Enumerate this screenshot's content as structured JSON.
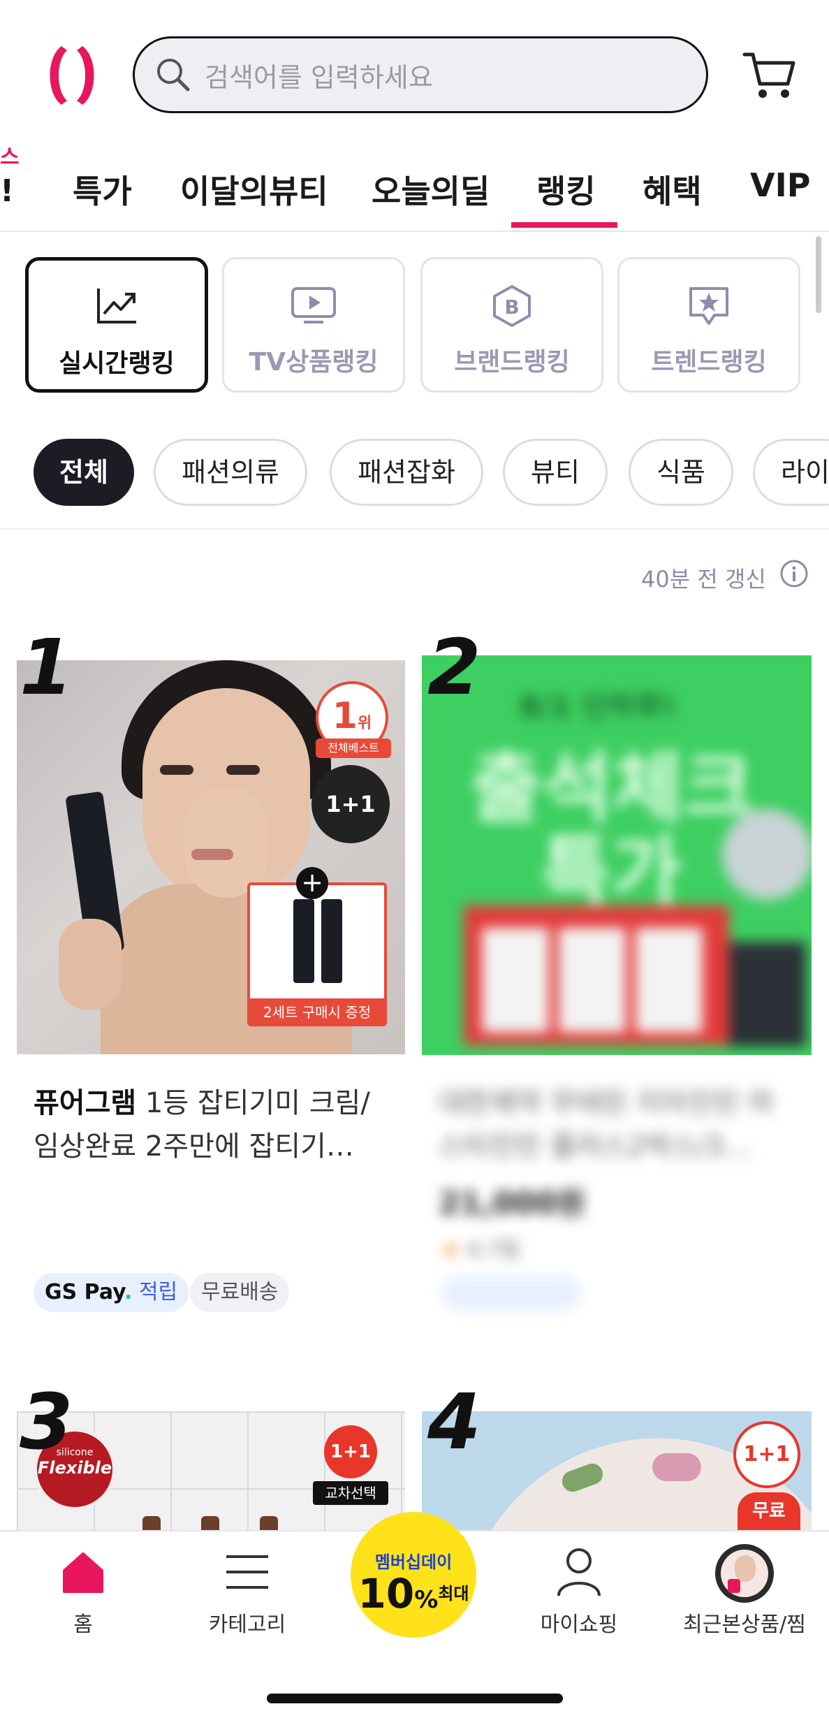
{
  "header": {
    "search_placeholder": "검색어를 입력하세요",
    "icons": [
      "brand-logo",
      "search-icon",
      "cart-icon"
    ]
  },
  "top_tabs": {
    "peek_partial_top": "스",
    "peek_partial": "!",
    "items": [
      "특가",
      "이달의뷰티",
      "오늘의딜",
      "랭킹",
      "혜택",
      "VIP"
    ],
    "active": "랭킹"
  },
  "ranking_types": [
    {
      "label": "실시간랭킹",
      "icon": "trend-chart-icon",
      "active": true
    },
    {
      "label": "TV상품랭킹",
      "icon": "tv-play-icon",
      "active": false
    },
    {
      "label": "브랜드랭킹",
      "icon": "brand-b-icon",
      "active": false
    },
    {
      "label": "트렌드랭킹",
      "icon": "star-bubble-icon",
      "active": false
    }
  ],
  "categories": [
    "전체",
    "패션의류",
    "패션잡화",
    "뷰티",
    "식품",
    "라이"
  ],
  "active_category": "전체",
  "update_text": "40분 전 갱신",
  "products": [
    {
      "rank": "1",
      "brand": "퓨어그램",
      "title": "1등 잡티기미 크림/",
      "title_line2": "임상완료 2주만에 잡티기…",
      "img_badge_rank": "1",
      "img_badge_rank_suffix": "위",
      "img_badge_label": "전체베스트",
      "img_badge_promo": "1+1",
      "img_gift_label": "2세트 구매시 증정",
      "tags": [
        {
          "brand": "GS Pay",
          "text": "적립"
        },
        {
          "text": "무료배송"
        }
      ]
    },
    {
      "rank": "2",
      "banner_top": "8/1 단하루!",
      "banner_title1": "출석체크",
      "banner_title2": "특가",
      "price": "21,000원",
      "rating": "4.7점",
      "title": "대한제약 무테린 지아진민 마",
      "title_line2": "스타진민 플러스2박스/3…"
    },
    {
      "rank": "3",
      "img_badge_promo": "1+1",
      "img_badge_label": "교차선택",
      "seal_small": "silicone",
      "seal_big": "Flexible"
    },
    {
      "rank": "4",
      "img_badge_promo": "1+1",
      "img_badge_label": "무료"
    }
  ],
  "bottom_nav": {
    "items": [
      {
        "label": "홈",
        "icon": "home-icon"
      },
      {
        "label": "카테고리",
        "icon": "menu-icon"
      },
      {
        "label": "",
        "icon": "membership-day-badge"
      },
      {
        "label": "마이쇼핑",
        "icon": "user-icon"
      },
      {
        "label": "최근본상품/찜",
        "icon": "recent-product-thumb"
      }
    ],
    "promo_line1": "멤버십데이",
    "promo_big": "10",
    "promo_percent": "%",
    "promo_suffix": "최대"
  },
  "colors": {
    "accent": "#e8175d",
    "dark": "#1c1c24",
    "muted": "#9a99b5",
    "promo_yellow": "#ffe21a"
  }
}
